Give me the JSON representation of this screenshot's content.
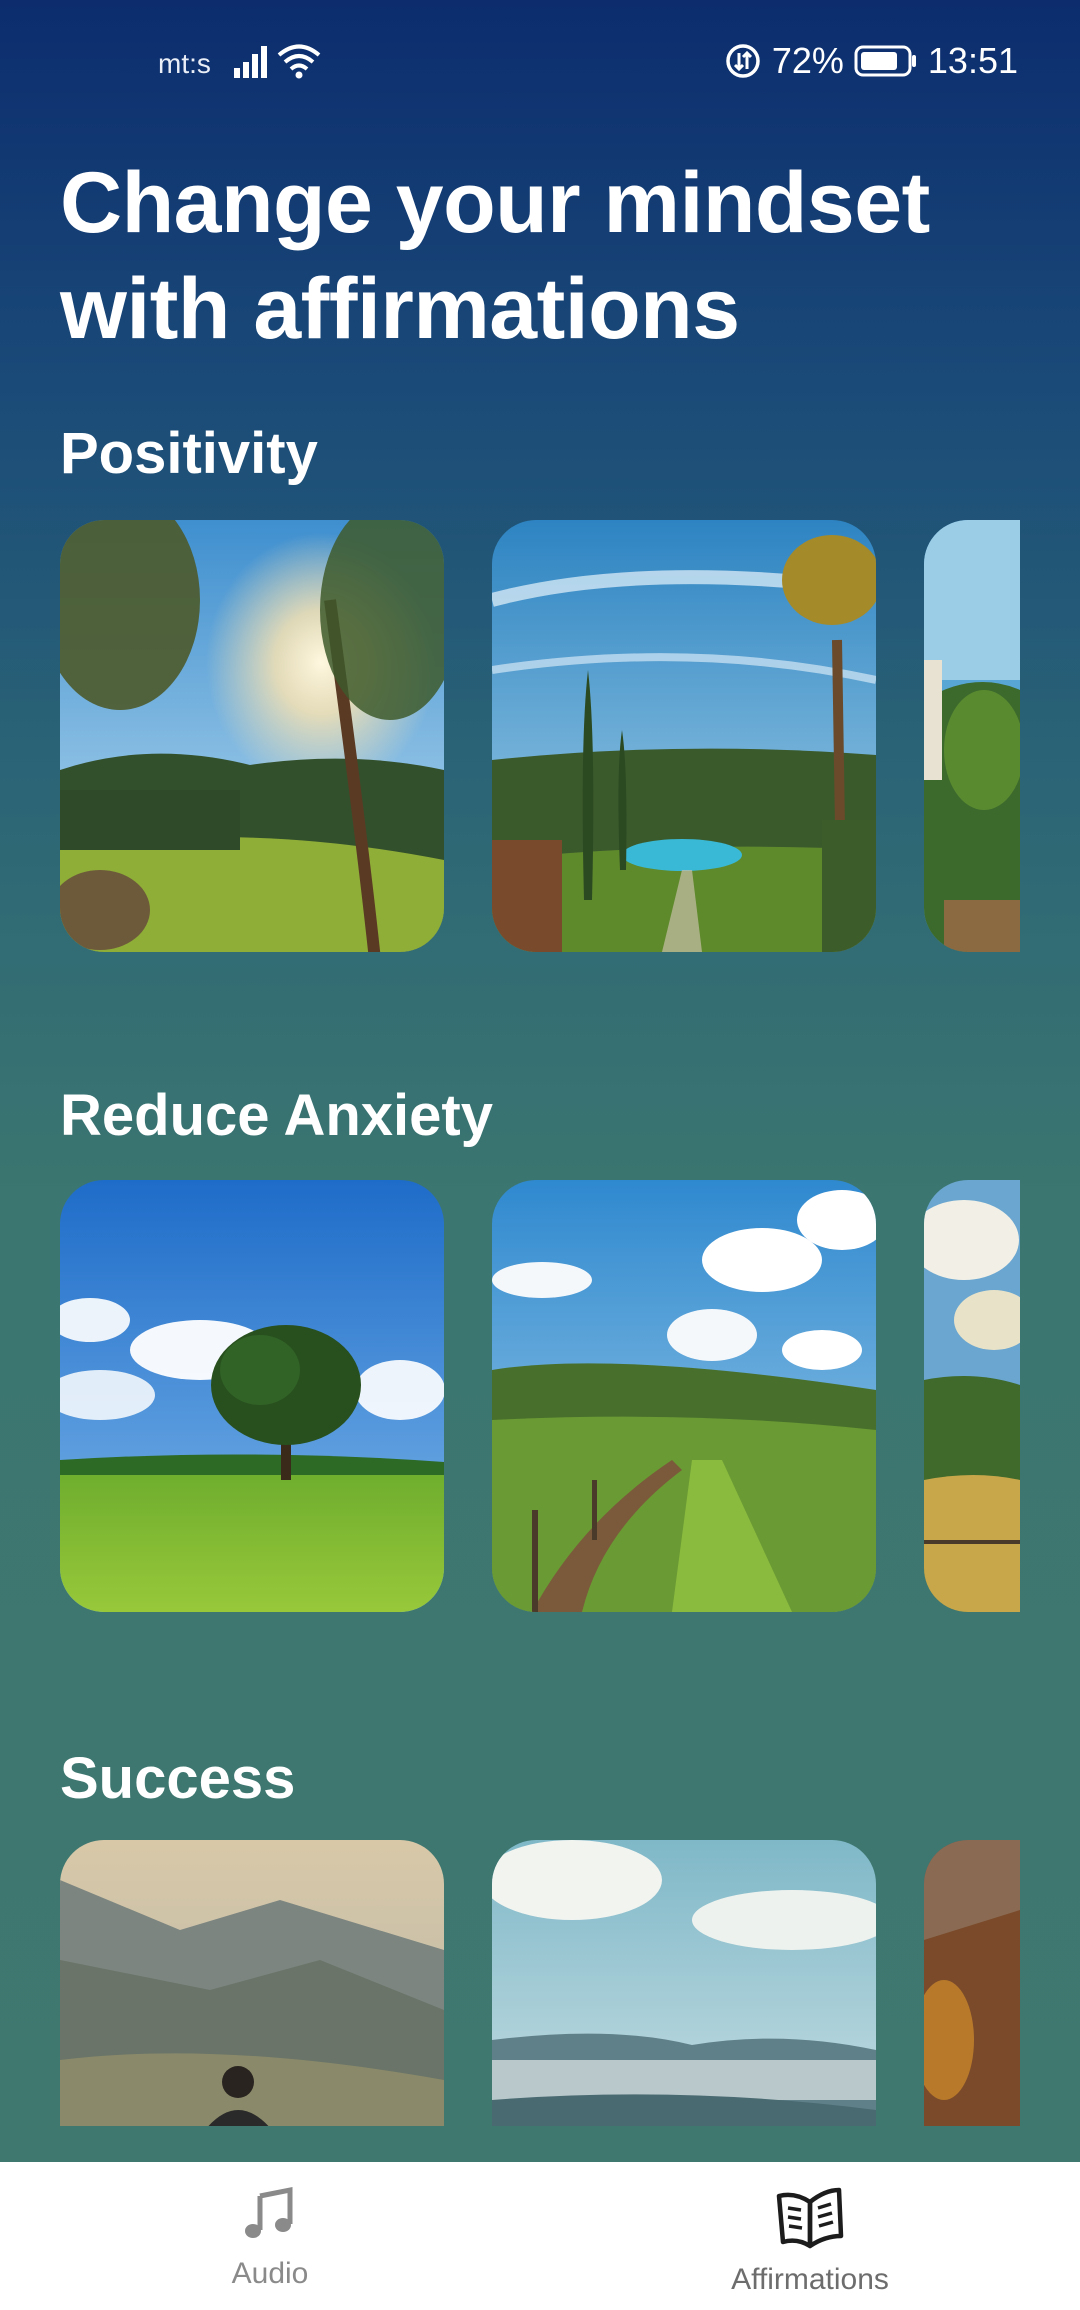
{
  "status_bar": {
    "carrier": "mt:s",
    "battery": "72%",
    "time": "13:51",
    "icons": [
      "signal-icon",
      "wifi-icon",
      "data-sync-icon",
      "battery-icon"
    ]
  },
  "headline": "Change your mindset with affirmations",
  "sections": [
    {
      "title": "Positivity"
    },
    {
      "title": "Reduce Anxiety"
    },
    {
      "title": "Success"
    }
  ],
  "bottom_nav": {
    "items": [
      {
        "label": "Audio",
        "icon": "music-note-icon"
      },
      {
        "label": "Affirmations",
        "icon": "open-book-icon"
      }
    ],
    "active_color": "#222222",
    "inactive_color": "#8a8a8a"
  },
  "colors": {
    "gradient_top": "#0c2c6e",
    "gradient_bottom": "#3f786f",
    "nav_bg": "#ffffff"
  }
}
